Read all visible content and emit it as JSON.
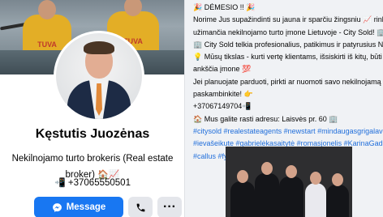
{
  "profile": {
    "name": "Kęstutis Juozėnas",
    "bio_line1": "Nekilnojamo turto brokeris (Real estate",
    "bio_line2": "broker)",
    "bio_emoji": "🏠📈",
    "phone_emoji": "📲",
    "phone": "+37065550501",
    "cover_text_left": "TUVA",
    "cover_text_right": "TUVA"
  },
  "actions": {
    "message_label": "Message",
    "call_icon": "📞",
    "more_icon": "···"
  },
  "post": {
    "lines": [
      "🎉 DĖMESIO !! 🎉",
      "Norime Jus supažindinti su jauna ir sparčiu žingsniu 📈 rinką",
      "užimančia nekilnojamo turto įmone Lietuvoje - City Sold! 🏢",
      "🏢 City Sold telkia profesionalius, patikimus ir patyrusius NT brok",
      "💡 Mūsų tikslas - kurti vertę klientams, išsiskirti iš kitų, būti patik",
      "ankščia įmone 💯",
      "Jei planuojate parduoti, pirkti ar nuomoti savo nekilnojamą turtą",
      "paskambinkite! 👉",
      "+37067149704📲",
      "🏠 Mus galite rasti adresu: Laisvės pr. 60 🏢"
    ],
    "hashtags": [
      "#citysold #realestateagents #newstart #mindaugasgrigalavičius",
      "#ievašeikute #gabrielėkasaitytė #romasjonelis #KarinaGadlijausk",
      "#callus #fyp"
    ]
  }
}
